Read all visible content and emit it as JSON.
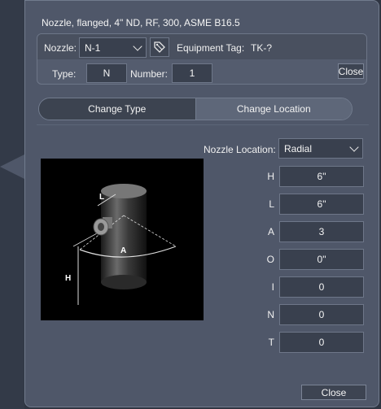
{
  "dialog": {
    "title": "Nozzle, flanged, 4\" ND, RF, 300, ASME B16.5",
    "nozzle_label": "Nozzle:",
    "nozzle_value": "N-1",
    "equipment_tag_label": "Equipment Tag:",
    "equipment_tag_value": "TK-?",
    "type_label": "Type:",
    "type_value": "N",
    "number_label": "Number:",
    "number_value": "1",
    "close_top": "Close",
    "tabs": [
      "Change Type",
      "Change Location"
    ],
    "active_tab": "Change Location",
    "location_label": "Nozzle Location:",
    "location_value": "Radial",
    "params": [
      {
        "label": "H",
        "value": "6\""
      },
      {
        "label": "L",
        "value": "6\""
      },
      {
        "label": "A",
        "value": "3"
      },
      {
        "label": "O",
        "value": "0\""
      },
      {
        "label": "I",
        "value": "0"
      },
      {
        "label": "N",
        "value": "0"
      },
      {
        "label": "T",
        "value": "0"
      }
    ],
    "close_bottom": "Close",
    "diagram_labels": {
      "length": "L",
      "angle": "A",
      "height": "H"
    }
  },
  "colors": {
    "panel": "#4f5769",
    "field": "#39404e",
    "background": "#2f3542"
  }
}
